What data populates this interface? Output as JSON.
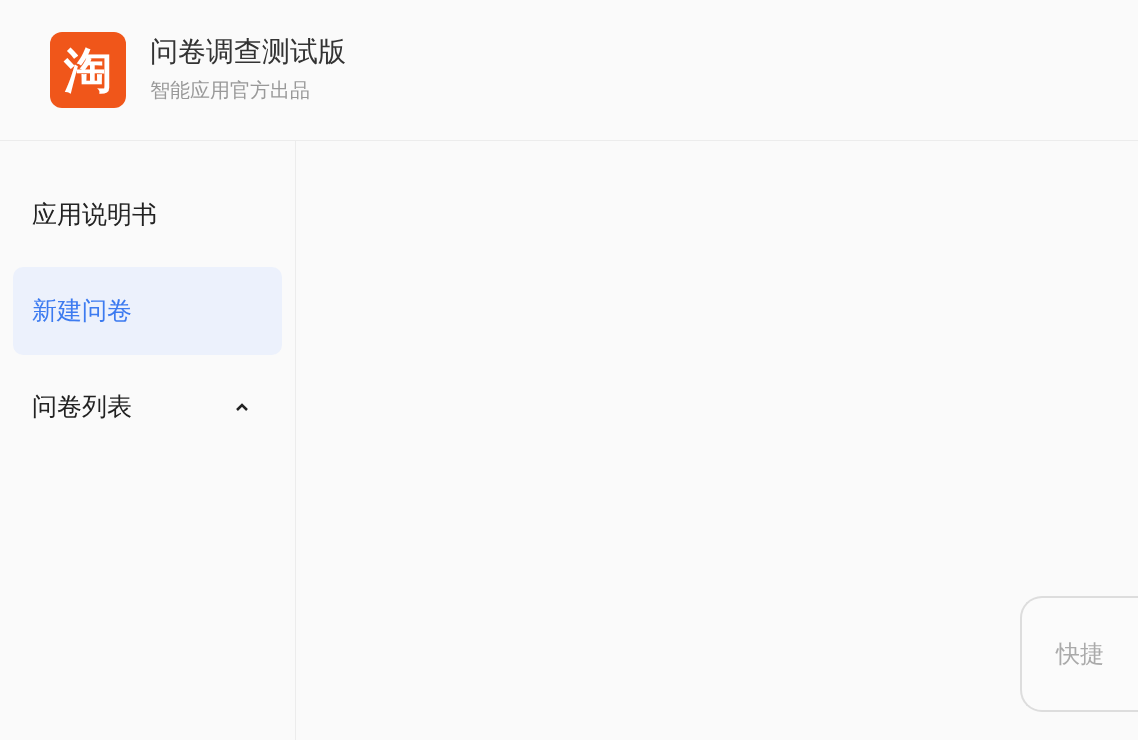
{
  "header": {
    "logo_text": "淘",
    "title": "问卷调查测试版",
    "subtitle": "智能应用官方出品"
  },
  "sidebar": {
    "items": [
      {
        "label": "应用说明书",
        "selected": false
      },
      {
        "label": "新建问卷",
        "selected": true
      },
      {
        "label": "问卷列表",
        "selected": false,
        "expanded": true
      }
    ]
  },
  "quick_button": {
    "label": "快捷"
  }
}
